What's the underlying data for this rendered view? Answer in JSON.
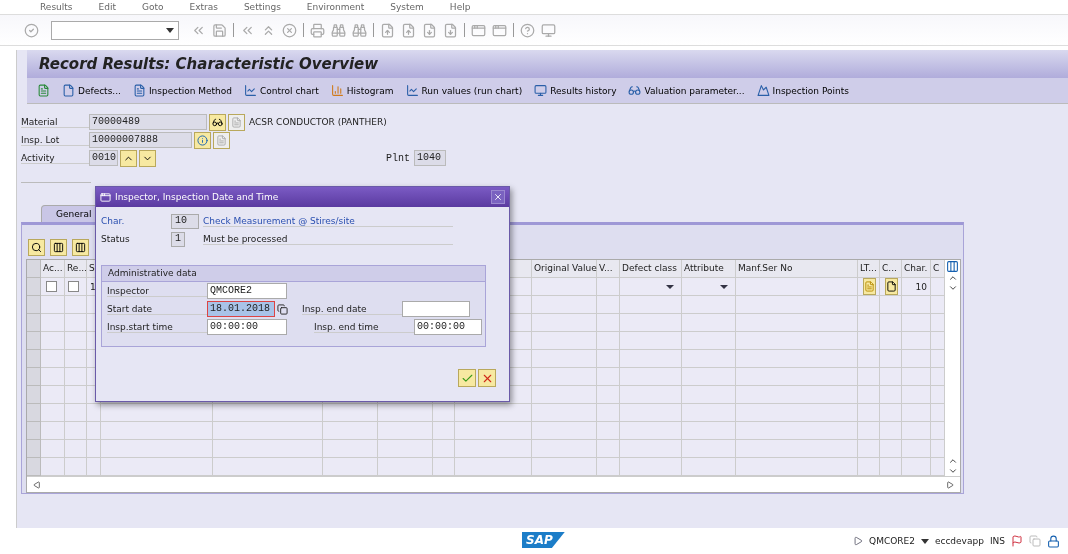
{
  "menu": [
    "Results",
    "Edit",
    "Goto",
    "Extras",
    "Settings",
    "Environment",
    "System",
    "Help"
  ],
  "title": "Record Results: Characteristic Overview",
  "app_toolbar": [
    {
      "label": "Defects..."
    },
    {
      "label": "Inspection Method"
    },
    {
      "label": "Control chart"
    },
    {
      "label": "Histogram"
    },
    {
      "label": "Run values (run chart)"
    },
    {
      "label": "Results history"
    },
    {
      "label": "Valuation parameter..."
    },
    {
      "label": "Inspection Points"
    }
  ],
  "header": {
    "material": {
      "label": "Material",
      "value": "70000489",
      "description": "ACSR CONDUCTOR (PANTHER)"
    },
    "insp_lot": {
      "label": "Insp. Lot",
      "value": "10000007888"
    },
    "activity": {
      "label": "Activity",
      "value": "0010"
    },
    "plant": {
      "label": "Plnt",
      "value": "1040"
    }
  },
  "tabs": [
    {
      "label": "General",
      "selected": true
    }
  ],
  "table": {
    "columns": [
      "Ac...",
      "Re...",
      "S",
      "Original Value",
      "V...",
      "Defect class",
      "Attribute",
      "Manf.Ser No",
      "LT...",
      "C...",
      "Char.",
      "C"
    ],
    "rows": [
      {
        "checks": [
          false,
          false
        ],
        "s": "1",
        "char": "10"
      }
    ]
  },
  "dialog": {
    "title": "Inspector, Inspection Date and Time",
    "char": {
      "label": "Char.",
      "value": "10",
      "text": "Check Measurement @ Stires/site"
    },
    "status": {
      "label": "Status",
      "value": "1",
      "text": "Must be processed"
    },
    "group_title": "Administrative data",
    "rows": [
      {
        "label": "Inspector",
        "value": "QMCORE2",
        "focused": false
      },
      {
        "label": "Start date",
        "value": "18.01.2018",
        "focused": true,
        "right_label": "Insp. end date",
        "right_value": ""
      },
      {
        "label": "Insp.start time",
        "value": "00:00:00",
        "focused": false,
        "right_label": "Insp. end time",
        "right_value": "00:00:00"
      }
    ]
  },
  "status_bar": {
    "logo": "SAP",
    "user": "QMCORE2",
    "server": "eccdevapp",
    "mode": "INS"
  }
}
